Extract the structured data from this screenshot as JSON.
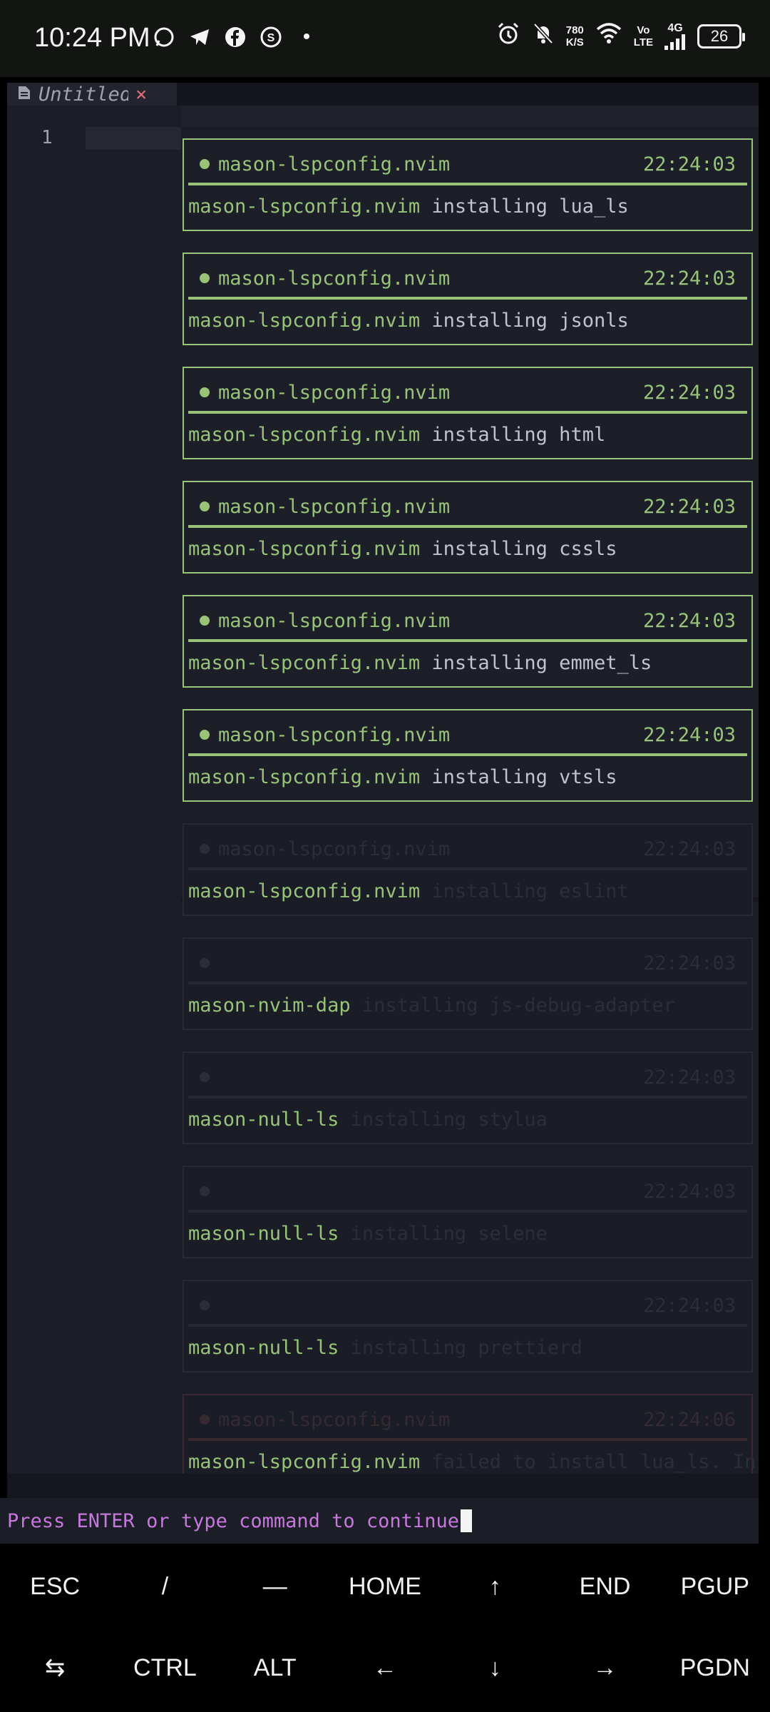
{
  "statusbar": {
    "time": "10:24 PM",
    "app_icons": [
      "whatsapp-icon",
      "telegram-icon",
      "facebook-icon",
      "app-s-icon"
    ],
    "dot": "•",
    "speed_value": "780",
    "speed_unit": "K/S",
    "volte_top": "Vo",
    "volte_bottom": "LTE",
    "network": "4G",
    "battery": "26"
  },
  "editor": {
    "tab_label": "Untitled",
    "tab_close": "×",
    "line_number": "1"
  },
  "notifications": [
    {
      "title": "mason-lspconfig.nvim",
      "time": "22:24:03",
      "source": "mason-lspconfig.nvim",
      "message": "installing lua_ls",
      "state": "active"
    },
    {
      "title": "mason-lspconfig.nvim",
      "time": "22:24:03",
      "source": "mason-lspconfig.nvim",
      "message": "installing jsonls",
      "state": "active"
    },
    {
      "title": "mason-lspconfig.nvim",
      "time": "22:24:03",
      "source": "mason-lspconfig.nvim",
      "message": "installing html",
      "state": "active"
    },
    {
      "title": "mason-lspconfig.nvim",
      "time": "22:24:03",
      "source": "mason-lspconfig.nvim",
      "message": "installing cssls",
      "state": "active"
    },
    {
      "title": "mason-lspconfig.nvim",
      "time": "22:24:03",
      "source": "mason-lspconfig.nvim",
      "message": "installing emmet_ls",
      "state": "active"
    },
    {
      "title": "mason-lspconfig.nvim",
      "time": "22:24:03",
      "source": "mason-lspconfig.nvim",
      "message": "installing vtsls",
      "state": "active"
    },
    {
      "title": "mason-lspconfig.nvim",
      "time": "22:24:03",
      "source": "mason-lspconfig.nvim",
      "message": "installing eslint",
      "state": "faded"
    },
    {
      "title": "",
      "time": "22:24:03",
      "source": "mason-nvim-dap",
      "message": "installing js-debug-adapter",
      "state": "faded"
    },
    {
      "title": "",
      "time": "22:24:03",
      "source": "mason-null-ls",
      "message": "installing stylua",
      "state": "faded"
    },
    {
      "title": "",
      "time": "22:24:03",
      "source": "mason-null-ls",
      "message": "installing selene",
      "state": "faded"
    },
    {
      "title": "",
      "time": "22:24:03",
      "source": "mason-null-ls",
      "message": "installing prettierd",
      "state": "faded"
    },
    {
      "title": "mason-lspconfig.nvim",
      "time": "22:24:06",
      "source": "mason-lspconfig.nvim",
      "message": "failed to install lua_ls. In",
      "state": "faded-red"
    }
  ],
  "cmdline": {
    "prompt": "Press ENTER or type command to continue"
  },
  "extra_keys": {
    "row1": [
      "ESC",
      "/",
      "—",
      "HOME",
      "↑",
      "END",
      "PGUP"
    ],
    "row2": [
      "⇆",
      "CTRL",
      "ALT",
      "←",
      "↓",
      "→",
      "PGDN"
    ]
  }
}
